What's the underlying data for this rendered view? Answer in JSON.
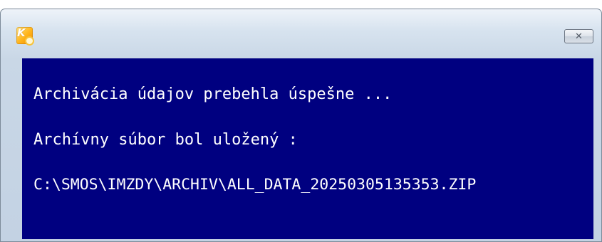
{
  "window": {
    "app_icon": "k-logo-icon",
    "close_icon": "close-icon",
    "close_glyph": "✕"
  },
  "message": {
    "line1": "Archivácia údajov prebehla úspešne ...",
    "line2": "Archívny súbor bol uložený :",
    "line3": "C:\\SMOS\\IMZDY\\ARCHIV\\ALL_DATA_20250305135353.ZIP"
  },
  "colors": {
    "panel_background": "#000080",
    "text": "#ffffff"
  }
}
